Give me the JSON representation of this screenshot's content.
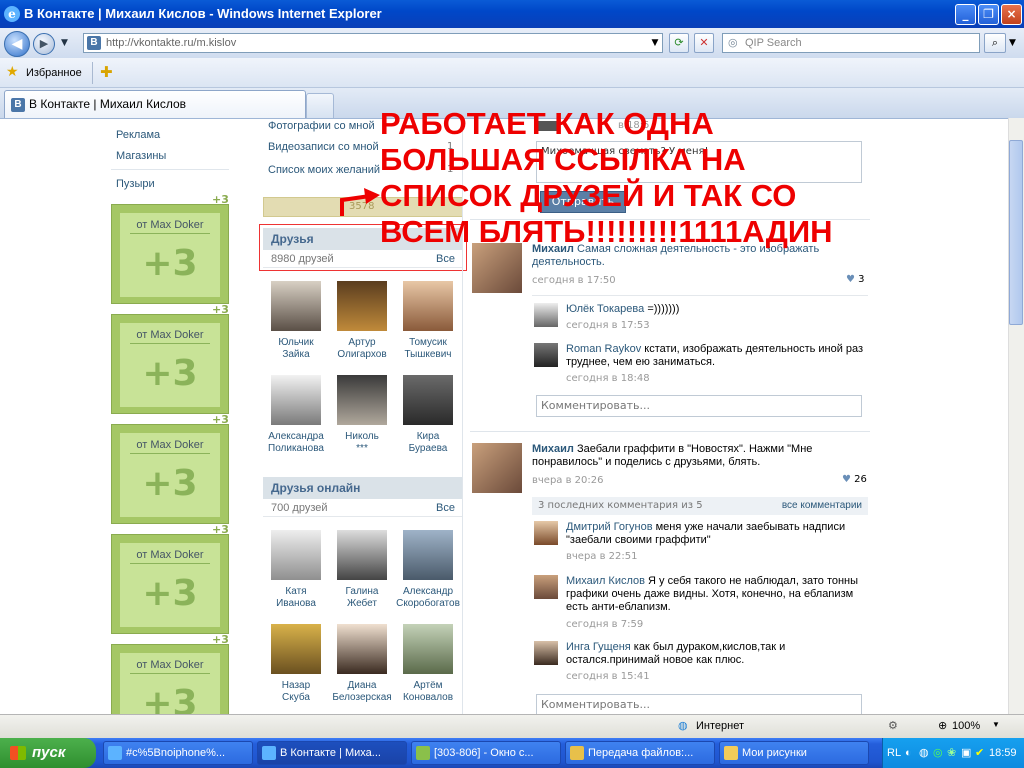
{
  "window": {
    "title": "В Контакте | Михаил Кислов - Windows Internet Explorer"
  },
  "nav": {
    "address": "http://vkontakte.ru/m.kislov",
    "search_placeholder": "QIP Search",
    "favorites": "Избранное"
  },
  "tab": {
    "title": "В Контакте | Михаил Кислов"
  },
  "left_menu": {
    "items": [
      "Реклама",
      "Магазины",
      "Пузыри"
    ]
  },
  "ads": [
    {
      "from": "от Max Doker",
      "value": "+3",
      "badge": "+3"
    },
    {
      "from": "от Max Doker",
      "value": "+3",
      "badge": "+3"
    },
    {
      "from": "от Max Doker",
      "value": "+3",
      "badge": "+3"
    },
    {
      "from": "от Max Doker",
      "value": "+3",
      "badge": "+3"
    },
    {
      "from": "от Max Doker",
      "value": "+3",
      "badge": "+3"
    }
  ],
  "profile_links": [
    "Фотографии со мной",
    "Видеозаписи со мной",
    "Список моих желаний"
  ],
  "profile_counts": [
    "1",
    "1"
  ],
  "rating_text": "3578",
  "friends": {
    "title": "Друзья",
    "count": "8980 друзей",
    "all": "Все",
    "list": [
      {
        "first": "Юльчик",
        "last": "Зайка"
      },
      {
        "first": "Артур",
        "last": "Олигархов"
      },
      {
        "first": "Томусик",
        "last": "Тышкевич"
      },
      {
        "first": "Александра",
        "last": "Поликанова"
      },
      {
        "first": "Николь",
        "last": "***"
      },
      {
        "first": "Кира",
        "last": "Бураева"
      }
    ]
  },
  "friends_online": {
    "title": "Друзья онлайн",
    "count": "700 друзей",
    "all": "Все",
    "list": [
      {
        "first": "Катя",
        "last": "Иванова"
      },
      {
        "first": "Галина",
        "last": "Жебет"
      },
      {
        "first": "Александр",
        "last": "Скоробогатов"
      },
      {
        "first": "Назар",
        "last": "Скуба"
      },
      {
        "first": "Диана",
        "last": "Белозерская"
      },
      {
        "first": "Артём",
        "last": "Коновалов"
      }
    ]
  },
  "wall_top": {
    "time": "в 18:5",
    "message": "Михоемачшая свемзть? У меня!",
    "send": "Отправить"
  },
  "annotation": "РАБОТАЕТ КАК ОДНА БОЛЬШАЯ ССЫЛКА НА СПИСОК ДРУЗЕЙ И ТАК СО ВСЕМ БЛЯТЬ!!!!!!!!!1111АДИН",
  "posts": [
    {
      "author": "Михаил",
      "text": "Самая сложная деятельность - это изображать деятельность.",
      "time": "сегодня в 17:50",
      "likes": "3",
      "comments": [
        {
          "author": "Юлёк Токарева",
          "text": "=)))))))",
          "time": "сегодня в 17:53"
        },
        {
          "author": "Roman Raykov",
          "text": "кстати, изображать деятельность иной раз труднее, чем ею заниматься.",
          "time": "сегодня в 18:48"
        }
      ],
      "comment_placeholder": "Комментировать..."
    },
    {
      "author": "Михаил",
      "text": "Заебали граффити в \"Новостях\". Нажми \"Мне понравилось\" и поделись с друзьями, блять.",
      "time": "вчера в 20:26",
      "likes": "26",
      "comments_summary": "3 последних комментария из 5",
      "all_comments": "все комментарии",
      "comments": [
        {
          "author": "Дмитрий Гогунов",
          "text": "меня уже начали заебывать надписи \"заебали своими граффити\"",
          "time": "вчера в 22:51"
        },
        {
          "author": "Михаил Кислов",
          "text": "Я у себя такого не наблюдал, зато тонны графики очень даже видны. Хотя, конечно, на еблanизм есть анти-еблanизм.",
          "time": "сегодня в 7:59"
        },
        {
          "author": "Инга Гущеня",
          "text": "как был дураком,кислов,так и остался.принимай новое как плюс.",
          "time": "сегодня в 15:41"
        }
      ],
      "comment_placeholder": "Комментировать..."
    }
  ],
  "status": {
    "zone": "Интернет",
    "zoom": "100%"
  },
  "taskbar": {
    "start": "пуск",
    "buttons": [
      "#c%5Bnoiphone%...",
      "В Контакте | Миха...",
      "[303-806] - Окно с...",
      "Передача файлов:...",
      "Мои рисунки"
    ],
    "lang": "RL",
    "clock": "18:59"
  },
  "colors": {
    "title_blue": "#0a5bd6",
    "vk_link": "#2b587a",
    "vk_header": "#45688e",
    "ad_green": "#a5c765",
    "annotation_red": "#e00000",
    "taskbar_blue": "#245edb",
    "start_green": "#3fa33f"
  }
}
